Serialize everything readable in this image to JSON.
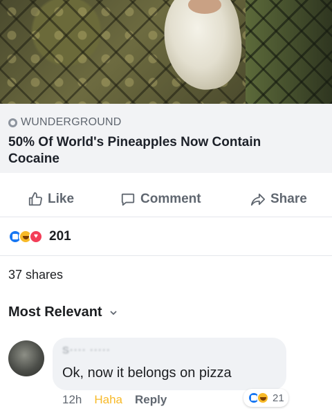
{
  "link_preview": {
    "source": "WUNDERGROUND",
    "headline": "50% Of World's Pineapples Now Contain Cocaine"
  },
  "actions": {
    "like_label": "Like",
    "comment_label": "Comment",
    "share_label": "Share"
  },
  "reactions": {
    "types": [
      "like",
      "haha",
      "love"
    ],
    "count": "201"
  },
  "shares": {
    "text": "37 shares"
  },
  "comments": {
    "sort_label": "Most Relevant",
    "items": [
      {
        "author": "S···· ·····",
        "text": "Ok, now it belongs on pizza",
        "time": "12h",
        "reacted_label": "Haha",
        "reply_label": "Reply",
        "reaction_count": "21"
      }
    ]
  },
  "colors": {
    "accent": "#1877f2",
    "haha": "#f7b928",
    "love": "#f33e58",
    "muted_text": "#606770"
  }
}
